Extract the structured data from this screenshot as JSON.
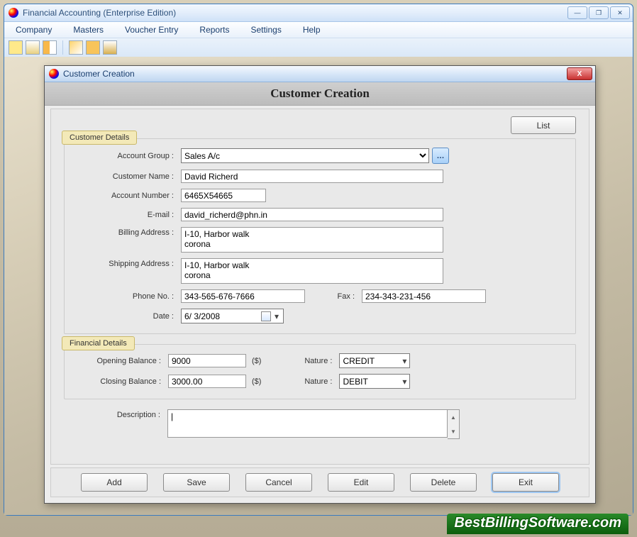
{
  "app": {
    "title": "Financial Accounting (Enterprise Edition)"
  },
  "menus": [
    "Company",
    "Masters",
    "Voucher Entry",
    "Reports",
    "Settings",
    "Help"
  ],
  "dialog": {
    "title": "Customer Creation",
    "heading": "Customer Creation",
    "list_btn": "List",
    "customer_legend": "Customer Details",
    "financial_legend": "Financial Details",
    "labels": {
      "account_group": "Account Group :",
      "customer_name": "Customer Name :",
      "account_number": "Account Number :",
      "email": "E-mail :",
      "billing": "Billing Address :",
      "shipping": "Shipping Address :",
      "phone": "Phone No. :",
      "fax": "Fax :",
      "date": "Date :",
      "opening": "Opening Balance :",
      "closing": "Closing Balance :",
      "nature": "Nature :",
      "description": "Description :",
      "currency": "($)"
    },
    "values": {
      "account_group": "Sales A/c",
      "customer_name": "David Richerd",
      "account_number": "6465X54665",
      "email": "david_richerd@phn.in",
      "billing": "I-10, Harbor walk\ncorona",
      "shipping": "I-10, Harbor walk\ncorona",
      "phone": "343-565-676-7666",
      "fax": "234-343-231-456",
      "date": "6/  3/2008",
      "opening": "9000",
      "closing": "3000.00",
      "nature1": "CREDIT",
      "nature2": "DEBIT",
      "description": "|"
    },
    "buttons": {
      "add": "Add",
      "save": "Save",
      "cancel": "Cancel",
      "edit": "Edit",
      "delete": "Delete",
      "exit": "Exit"
    }
  },
  "watermark": "BestBillingSoftware.com"
}
